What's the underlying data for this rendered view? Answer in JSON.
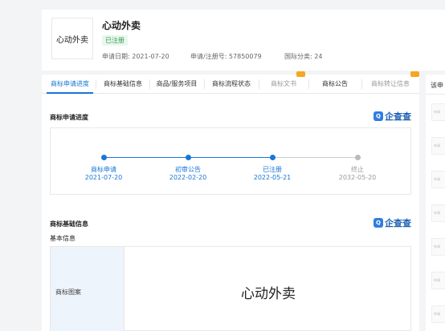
{
  "header": {
    "logo_text": "心动外卖",
    "brand_name": "心动外卖",
    "status_badge": "已注册",
    "apply_date": "申请日期: 2021-07-20",
    "reg_no": "申请/注册号: 57850079",
    "intl_class": "国际分类: 24"
  },
  "tabs": [
    {
      "label": "商标申请进度"
    },
    {
      "label": "商标基础信息"
    },
    {
      "label": "商品/服务项目"
    },
    {
      "label": "商标流程状态"
    },
    {
      "label": "商标文书"
    },
    {
      "label": "商标公告"
    },
    {
      "label": "商标转让信息"
    }
  ],
  "progress": {
    "title": "商标申请进度",
    "brand_logo": "企查查",
    "steps": [
      {
        "label": "商标申请",
        "date": "2021-07-20"
      },
      {
        "label": "初审公告",
        "date": "2022-02-20"
      },
      {
        "label": "已注册",
        "date": "2022-05-21"
      },
      {
        "label": "终止",
        "date": "2032-05-20"
      }
    ]
  },
  "basic": {
    "title": "商标基础信息",
    "brand_logo": "企查查",
    "subtitle": "基本信息",
    "row_label": "商标图案",
    "row_value": "心动外卖"
  },
  "side": {
    "heading": "该申",
    "item_text": "申请"
  },
  "colors": {
    "accent": "#1677d8",
    "badge_bg": "#e9f7ec",
    "badge_text": "#3a9b4f",
    "tab_corner": "#f5a623"
  }
}
